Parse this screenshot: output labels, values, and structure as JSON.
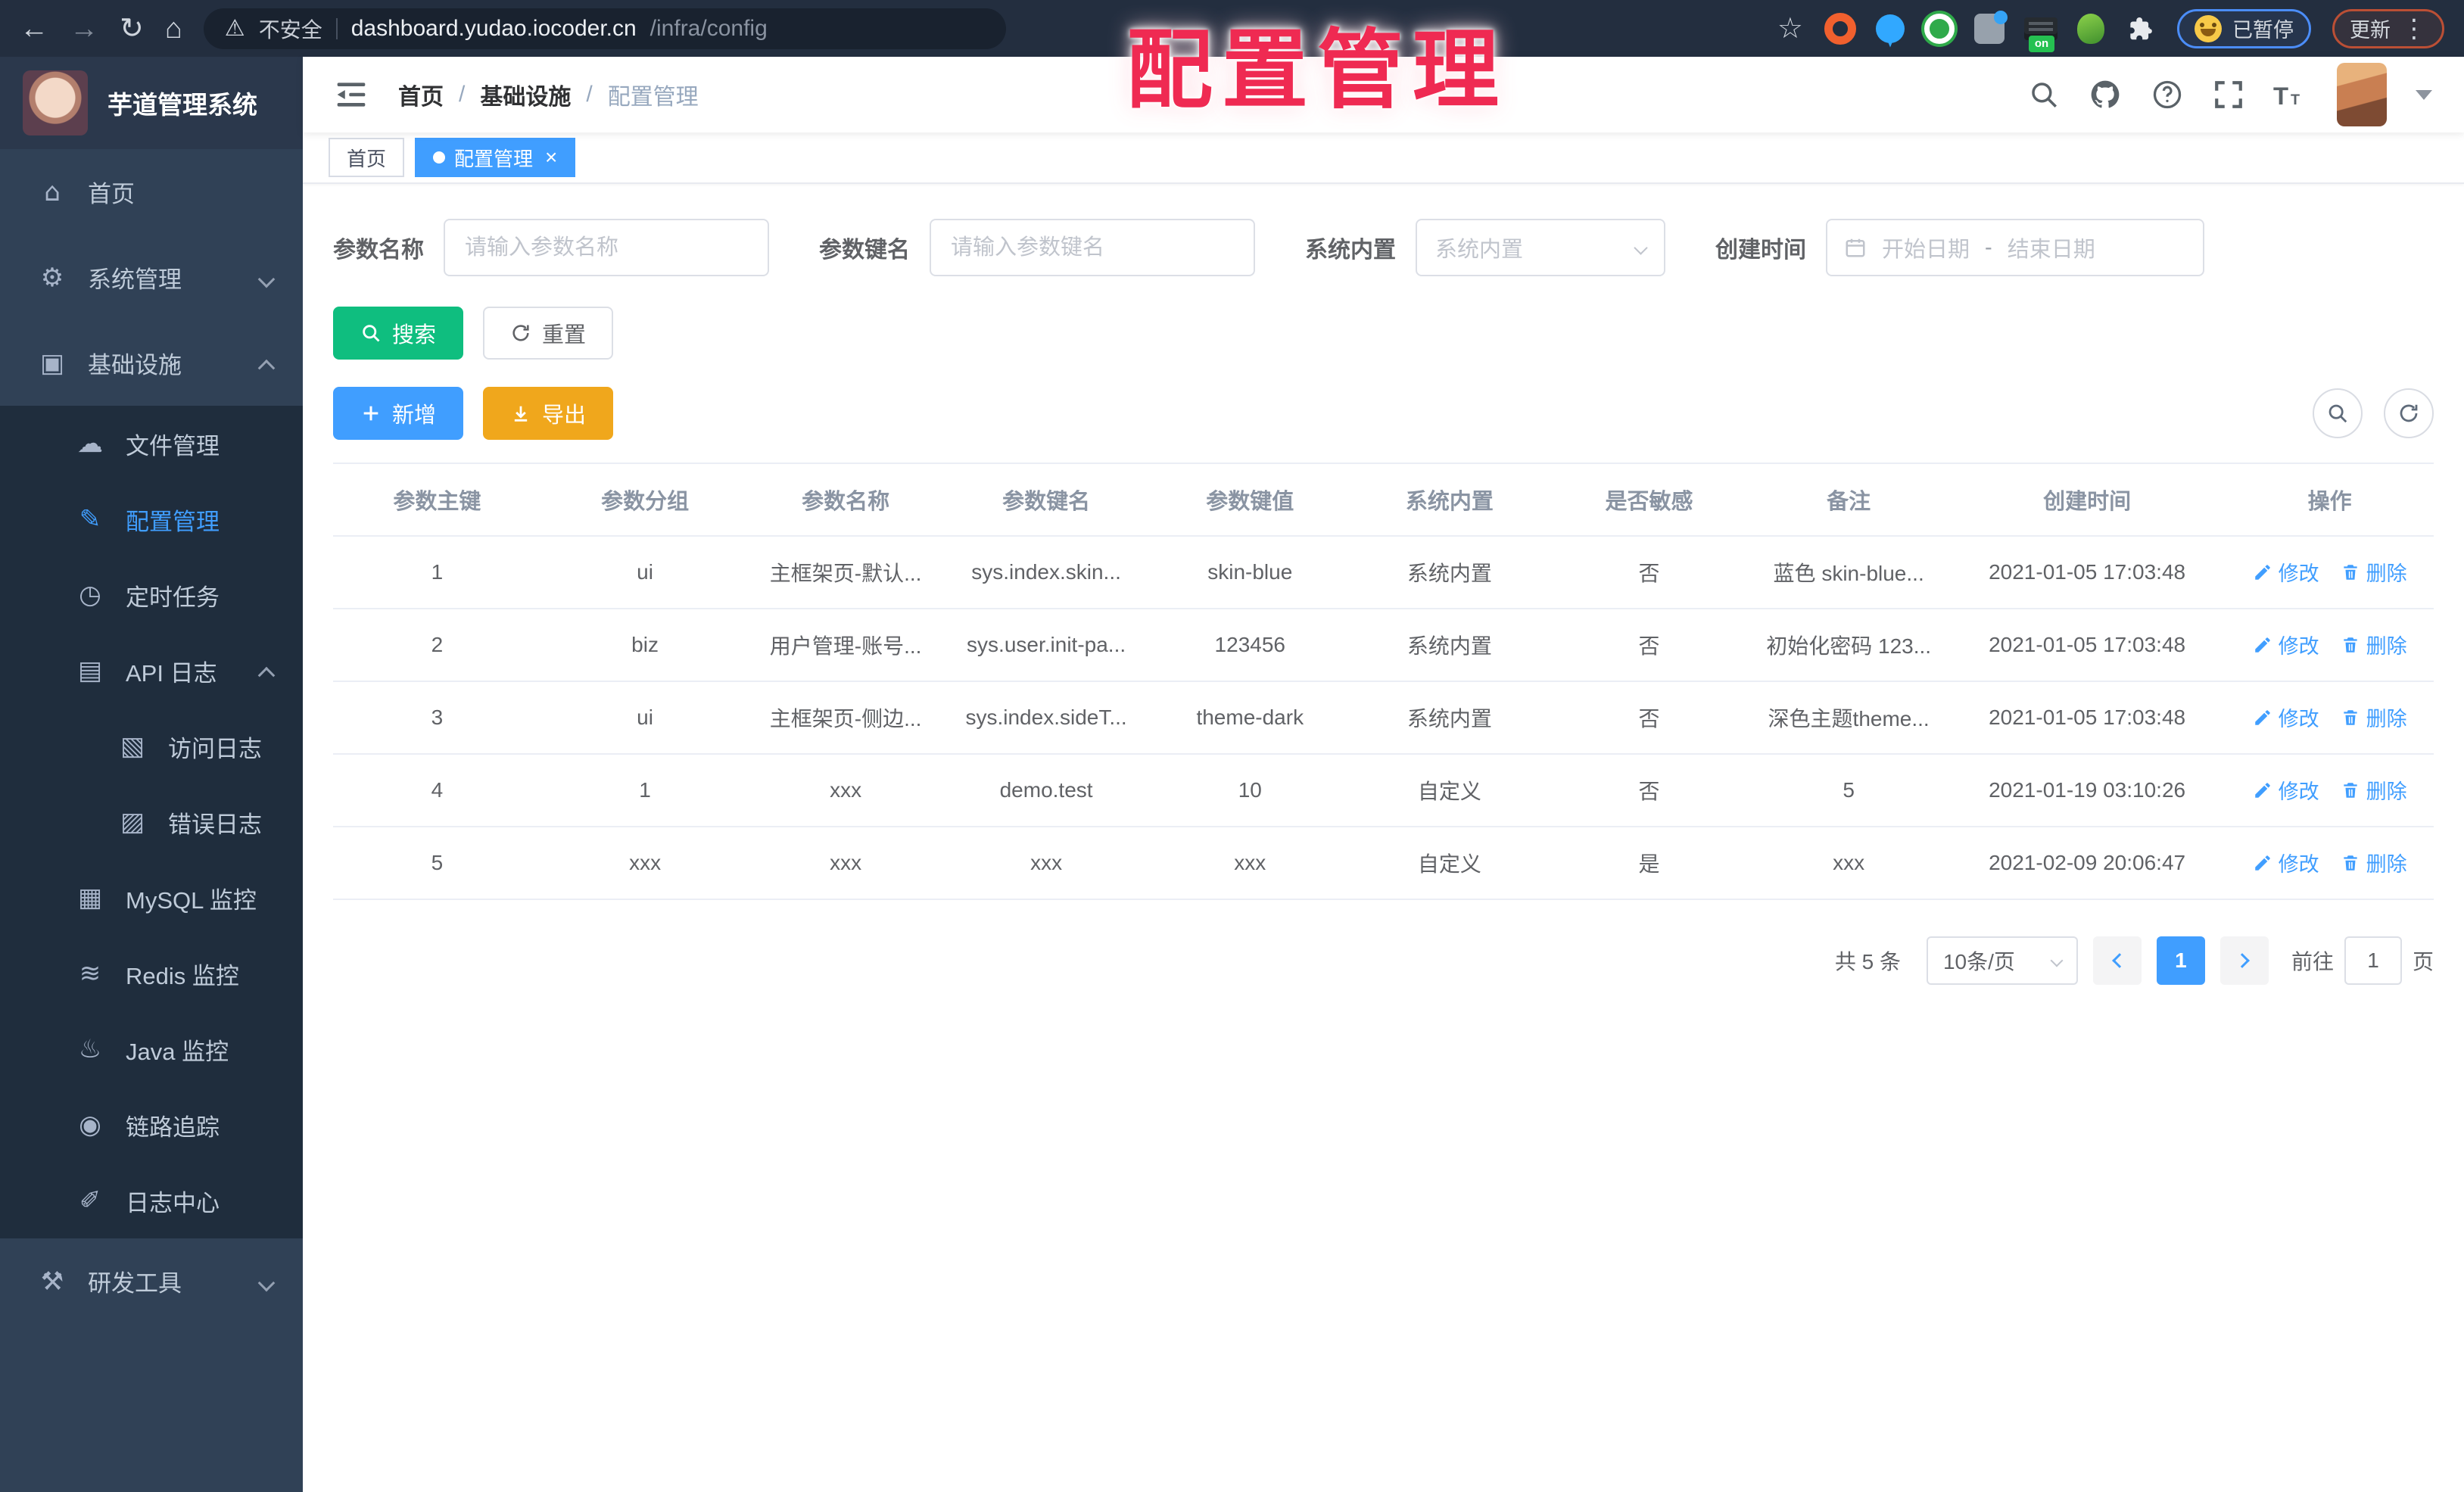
{
  "colors": {
    "accent": "#409eff",
    "success": "#0fbe7f",
    "warning": "#f0a71c",
    "overlay_red": "#ef2a52",
    "sidebar_bg": "#304156",
    "submenu_bg": "#1f2d3d"
  },
  "browser": {
    "address": {
      "security_text": "不安全",
      "host": "dashboard.yudao.iocoder.cn",
      "path": "/infra/config"
    },
    "extension_icons": [
      "orange-ring",
      "blue-pin",
      "green-shield",
      "gray-grid",
      "dark-list-on",
      "green-sprout",
      "white-puzzle"
    ],
    "badges": {
      "paused": "已暂停",
      "update": "更新"
    }
  },
  "overlay": {
    "title": "配置管理"
  },
  "sidebar": {
    "title": "芋道管理系统",
    "menu": [
      {
        "id": "home",
        "label": "首页",
        "icon": "home-icon",
        "level": 1
      },
      {
        "id": "system",
        "label": "系统管理",
        "icon": "gear-icon",
        "level": 1,
        "chevron": "down"
      },
      {
        "id": "infra",
        "label": "基础设施",
        "icon": "infra-icon",
        "level": 1,
        "chevron": "up"
      },
      {
        "id": "file",
        "label": "文件管理",
        "icon": "cloud-icon",
        "level": 2
      },
      {
        "id": "config",
        "label": "配置管理",
        "icon": "edit-icon",
        "level": 2,
        "active": true
      },
      {
        "id": "job",
        "label": "定时任务",
        "icon": "timer-icon",
        "level": 2
      },
      {
        "id": "api-log",
        "label": "API 日志",
        "icon": "log-icon",
        "level": 2,
        "chevron": "up"
      },
      {
        "id": "access-log",
        "label": "访问日志",
        "icon": "access-log-icon",
        "level": 3
      },
      {
        "id": "error-log",
        "label": "错误日志",
        "icon": "error-log-icon",
        "level": 3
      },
      {
        "id": "mysql",
        "label": "MySQL 监控",
        "icon": "mysql-icon",
        "level": 2
      },
      {
        "id": "redis",
        "label": "Redis 监控",
        "icon": "redis-icon",
        "level": 2
      },
      {
        "id": "java",
        "label": "Java 监控",
        "icon": "java-icon",
        "level": 2
      },
      {
        "id": "trace",
        "label": "链路追踪",
        "icon": "eye-icon",
        "level": 2
      },
      {
        "id": "log-center",
        "label": "日志中心",
        "icon": "log-edit-icon",
        "level": 2
      },
      {
        "id": "dev-tools",
        "label": "研发工具",
        "icon": "tools-icon",
        "level": 1,
        "chevron": "down"
      }
    ]
  },
  "navbar": {
    "breadcrumb": [
      "首页",
      "基础设施",
      "配置管理"
    ]
  },
  "tags": [
    {
      "label": "首页",
      "active": false,
      "closable": false
    },
    {
      "label": "配置管理",
      "active": true,
      "closable": true
    }
  ],
  "filters": [
    {
      "id": "param-name",
      "label": "参数名称",
      "type": "input",
      "placeholder": "请输入参数名称"
    },
    {
      "id": "param-key",
      "label": "参数键名",
      "type": "input",
      "placeholder": "请输入参数键名"
    },
    {
      "id": "builtin",
      "label": "系统内置",
      "type": "select",
      "placeholder": "系统内置"
    },
    {
      "id": "create-time",
      "label": "创建时间",
      "type": "daterange",
      "start": "开始日期",
      "separator": "-",
      "end": "结束日期"
    }
  ],
  "toolbar": {
    "search": "搜索",
    "reset": "重置",
    "add": "新增",
    "export": "导出"
  },
  "table": {
    "columns": [
      "参数主键",
      "参数分组",
      "参数名称",
      "参数键名",
      "参数键值",
      "系统内置",
      "是否敏感",
      "备注",
      "创建时间",
      "操作"
    ],
    "edit_label": "修改",
    "delete_label": "删除",
    "rows": [
      {
        "id": "1",
        "group": "ui",
        "name": "主框架页-默认...",
        "key": "sys.index.skin...",
        "value": "skin-blue",
        "builtin": "系统内置",
        "sensitive": "否",
        "remark": "蓝色 skin-blue...",
        "created": "2021-01-05 17:03:48"
      },
      {
        "id": "2",
        "group": "biz",
        "name": "用户管理-账号...",
        "key": "sys.user.init-pa...",
        "value": "123456",
        "builtin": "系统内置",
        "sensitive": "否",
        "remark": "初始化密码 123...",
        "created": "2021-01-05 17:03:48"
      },
      {
        "id": "3",
        "group": "ui",
        "name": "主框架页-侧边...",
        "key": "sys.index.sideT...",
        "value": "theme-dark",
        "builtin": "系统内置",
        "sensitive": "否",
        "remark": "深色主题theme...",
        "created": "2021-01-05 17:03:48"
      },
      {
        "id": "4",
        "group": "1",
        "name": "xxx",
        "key": "demo.test",
        "value": "10",
        "builtin": "自定义",
        "sensitive": "否",
        "remark": "5",
        "created": "2021-01-19 03:10:26"
      },
      {
        "id": "5",
        "group": "xxx",
        "name": "xxx",
        "key": "xxx",
        "value": "xxx",
        "builtin": "自定义",
        "sensitive": "是",
        "remark": "xxx",
        "created": "2021-02-09 20:06:47"
      }
    ]
  },
  "pagination": {
    "total": "共 5 条",
    "page_size": "10条/页",
    "current": "1",
    "jump_prefix": "前往",
    "jump_value": "1",
    "jump_suffix": "页"
  }
}
